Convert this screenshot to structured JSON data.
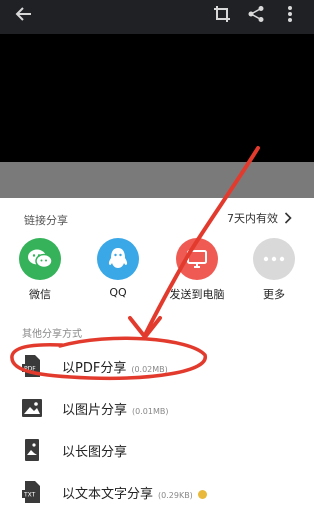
{
  "colors": {
    "topbar": "#1f2125",
    "wechat": "#35b25a",
    "qq": "#3aa7e6",
    "pc": "#ef5b53",
    "more": "#d9d9d9",
    "annotation": "#e23b2e"
  },
  "topbar": {
    "back_icon": "arrow-left-icon",
    "crop_icon": "crop-icon",
    "share_icon": "share-icon",
    "more_icon": "more-vertical-icon"
  },
  "sheet": {
    "link_share_title": "链接分享",
    "validity": "7天内有效",
    "apps": [
      {
        "label": "微信",
        "icon": "wechat-icon"
      },
      {
        "label": "QQ",
        "icon": "qq-icon"
      },
      {
        "label": "发送到电脑",
        "icon": "monitor-icon"
      },
      {
        "label": "更多",
        "icon": "more-horizontal-icon"
      }
    ],
    "other_title": "其他分享方式",
    "options": [
      {
        "label": "以PDF分享",
        "size": "(0.02MB)",
        "icon": "pdf-icon"
      },
      {
        "label": "以图片分享",
        "size": "(0.01MB)",
        "icon": "image-icon"
      },
      {
        "label": "以长图分享",
        "size": "",
        "icon": "long-image-icon"
      },
      {
        "label": "以文本文字分享",
        "size": "(0.29KB)",
        "icon": "txt-icon"
      }
    ]
  }
}
